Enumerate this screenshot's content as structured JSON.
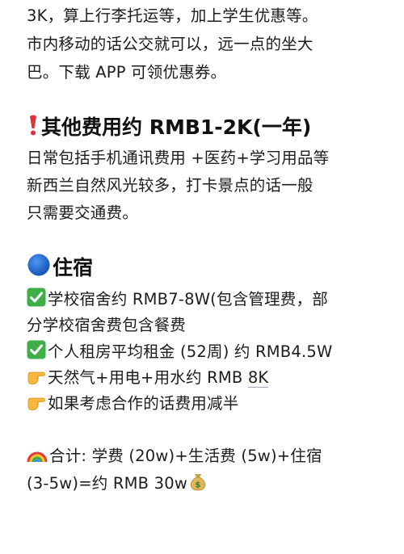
{
  "intro": {
    "line1": "3K，算上行李托运等，加上学生优惠等。",
    "line2": "市内移动的话公交就可以，远一点的坐大",
    "line3": "巴。下载 APP 可领优惠券。"
  },
  "other_costs": {
    "heading": "其他费用约 RMB1-2K(一年)",
    "line1": "日常包括手机通讯费用 +医药+学习用品等",
    "line2": "新西兰自然风光较多，打卡景点的话一般",
    "line3": "只需要交通费。"
  },
  "housing": {
    "heading": "住宿",
    "item1_line1": "学校宿舍约 RMB7-8W(包含管理费，部",
    "item1_line2": "分学校宿舍费包含餐费",
    "item2": "个人租房平均租金 (52周) 约 RMB4.5W",
    "item3_text": "天然气+用电+用水约 RMB ",
    "item3_amount": "8K",
    "item4": "如果考虑合作的话费用减半"
  },
  "total": {
    "line1": "合计: 学费 (20w)+生活费 (5w)+住宿",
    "line2": "(3-5w)=约 RMB 30w"
  },
  "icons": {
    "exclamation": "red-exclamation-heart-icon",
    "blue_circle": "blue-circle-icon",
    "check": "green-check-icon",
    "pointing_hand": "pointing-hand-icon",
    "rainbow": "rainbow-icon",
    "money_bag": "money-bag-icon"
  },
  "colors": {
    "text": "#1c1c1c",
    "check_green": "#3fae49",
    "blue_circle": "#1f6fd6",
    "exclamation_red": "#e0313b"
  }
}
